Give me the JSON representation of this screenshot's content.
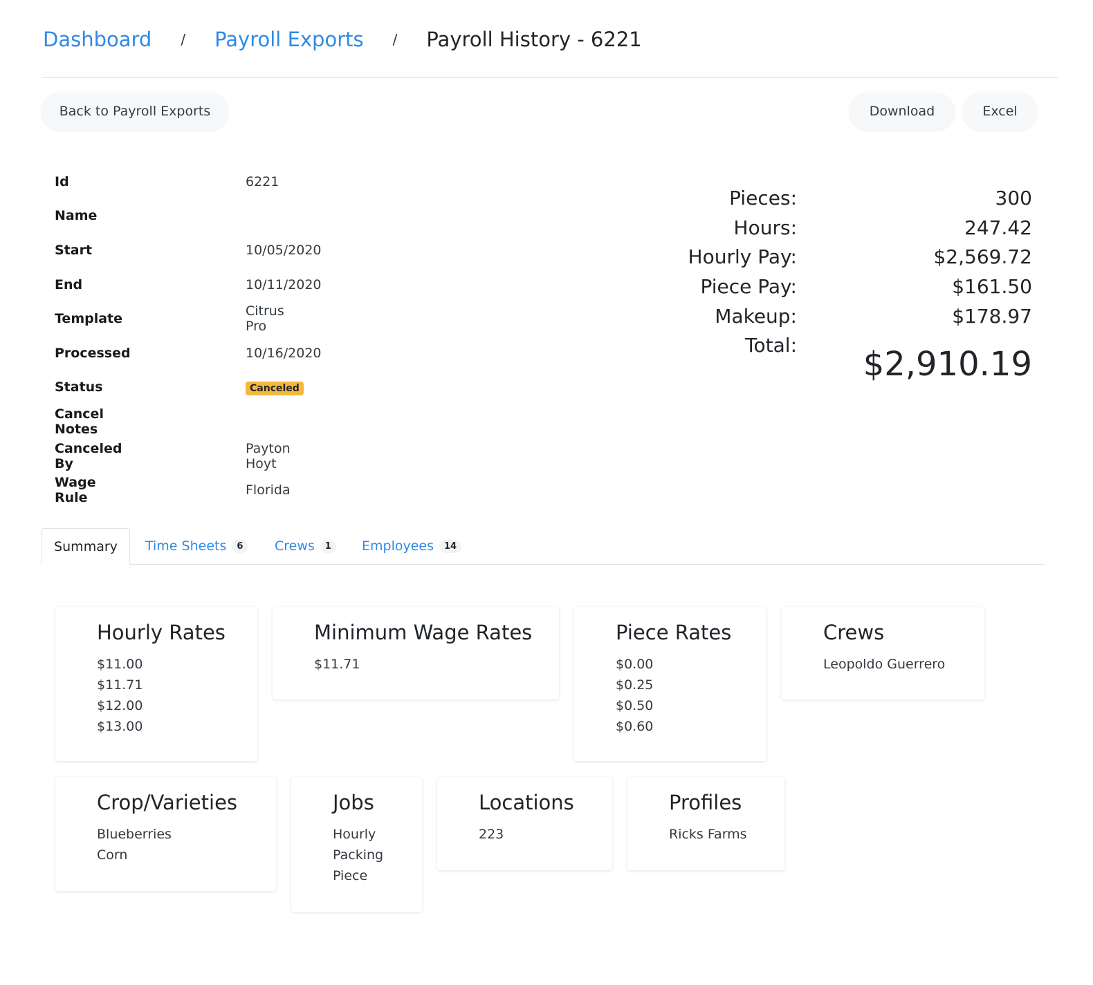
{
  "breadcrumb": {
    "dashboard": "Dashboard",
    "payroll_exports": "Payroll Exports",
    "separator": "/",
    "current": "Payroll History - 6221"
  },
  "actions": {
    "back": "Back to Payroll Exports",
    "download": "Download",
    "excel": "Excel"
  },
  "details": {
    "id_label": "Id",
    "id_value": "6221",
    "name_label": "Name",
    "name_value": "",
    "start_label": "Start",
    "start_value": "10/05/2020",
    "end_label": "End",
    "end_value": "10/11/2020",
    "template_label": "Template",
    "template_value": "Citrus Pro",
    "processed_label": "Processed",
    "processed_value": "10/16/2020",
    "status_label": "Status",
    "status_value": "Canceled",
    "cancel_notes_label": "Cancel Notes",
    "cancel_notes_value": "",
    "canceled_by_label": "Canceled By",
    "canceled_by_value": "Payton Hoyt",
    "wage_rule_label": "Wage Rule",
    "wage_rule_value": "Florida"
  },
  "totals": {
    "pieces_label": "Pieces:",
    "pieces_value": "300",
    "hours_label": "Hours:",
    "hours_value": "247.42",
    "hourly_pay_label": "Hourly Pay:",
    "hourly_pay_value": "$2,569.72",
    "piece_pay_label": "Piece Pay:",
    "piece_pay_value": "$161.50",
    "makeup_label": "Makeup:",
    "makeup_value": "$178.97",
    "total_label": "Total:",
    "total_value": "$2,910.19"
  },
  "tabs": {
    "summary": "Summary",
    "time_sheets": "Time Sheets",
    "time_sheets_count": "6",
    "crews": "Crews",
    "crews_count": "1",
    "employees": "Employees",
    "employees_count": "14"
  },
  "cards": {
    "hourly_rates": {
      "title": "Hourly Rates",
      "items": [
        "$11.00",
        "$11.71",
        "$12.00",
        "$13.00"
      ]
    },
    "minimum_wage_rates": {
      "title": "Minimum Wage Rates",
      "items": [
        "$11.71"
      ]
    },
    "piece_rates": {
      "title": "Piece Rates",
      "items": [
        "$0.00",
        "$0.25",
        "$0.50",
        "$0.60"
      ]
    },
    "crews": {
      "title": "Crews",
      "items": [
        "Leopoldo Guerrero"
      ]
    },
    "crop_varieties": {
      "title": "Crop/Varieties",
      "items": [
        "Blueberries",
        "Corn"
      ]
    },
    "jobs": {
      "title": "Jobs",
      "items": [
        "Hourly",
        "Packing",
        "Piece"
      ]
    },
    "locations": {
      "title": "Locations",
      "items": [
        "223"
      ]
    },
    "profiles": {
      "title": "Profiles",
      "items": [
        "Ricks Farms"
      ]
    }
  },
  "colors": {
    "link": "#2e8ae6",
    "status_badge": "#f5b83d"
  }
}
